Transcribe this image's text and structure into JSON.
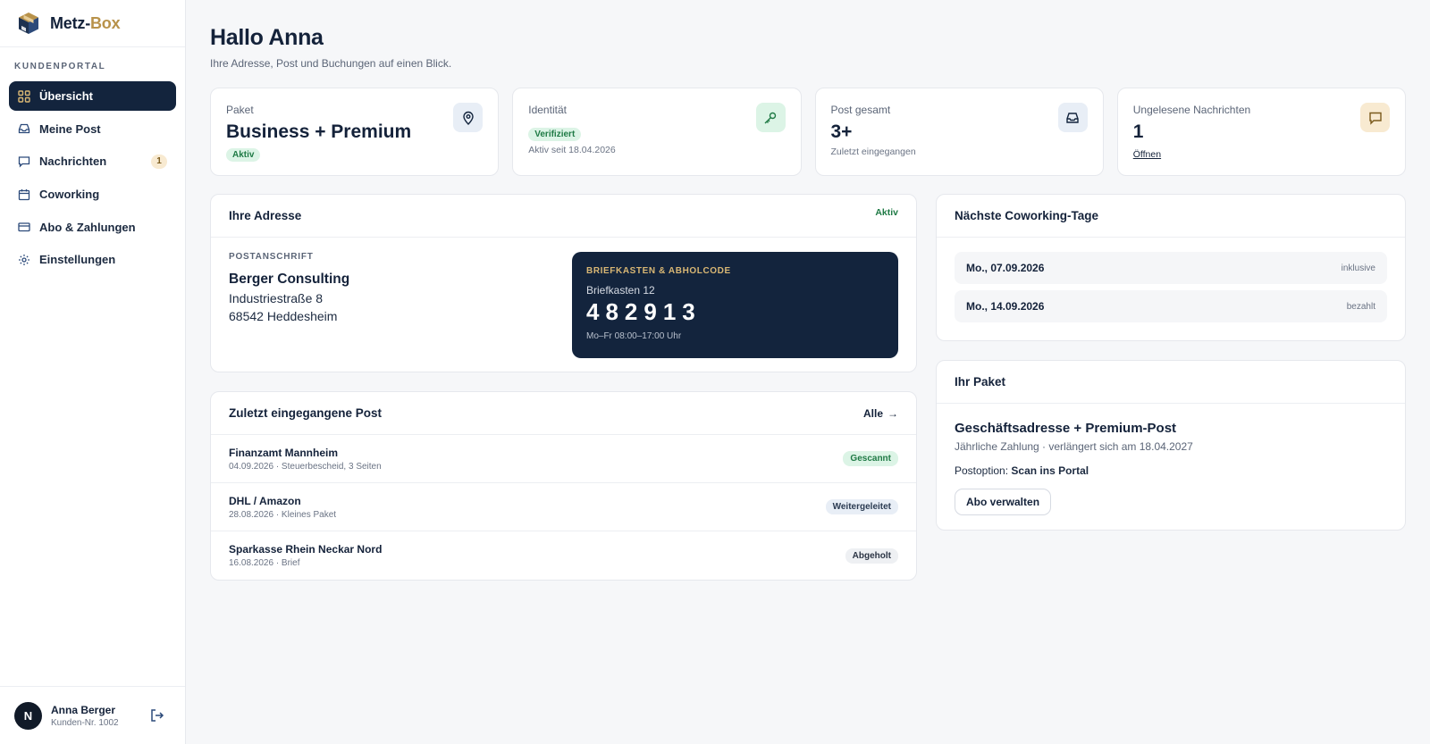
{
  "brand": {
    "name_main": "Metz-",
    "name_accent": "Box",
    "accent_color": "#b8924a"
  },
  "sidebar": {
    "section_label": "KUNDENPORTAL",
    "items": [
      {
        "label": "Übersicht",
        "icon": "grid-icon",
        "active": true
      },
      {
        "label": "Meine Post",
        "icon": "inbox-icon"
      },
      {
        "label": "Nachrichten",
        "icon": "message-icon",
        "badge": "1"
      },
      {
        "label": "Coworking",
        "icon": "calendar-icon"
      },
      {
        "label": "Abo & Zahlungen",
        "icon": "credit-card-icon"
      },
      {
        "label": "Einstellungen",
        "icon": "gear-icon"
      }
    ],
    "user": {
      "initial": "N",
      "name": "Anna Berger",
      "customer_no": "Kunden-Nr. 1002"
    }
  },
  "header": {
    "title": "Hallo Anna",
    "subtitle": "Ihre Adresse, Post und Buchungen auf einen Blick."
  },
  "stats": [
    {
      "label": "Paket",
      "value": "Business + Premium",
      "badge": "Aktiv",
      "icon": "location-pin-icon",
      "icon_bg": "#e8eef6"
    },
    {
      "label": "Identität",
      "badge": "Verifiziert",
      "sub": "Aktiv seit 18.04.2026",
      "icon": "key-icon",
      "icon_bg": "#dcf4e6"
    },
    {
      "label": "Post gesamt",
      "value": "3+",
      "sub": "Zuletzt eingegangen",
      "icon": "inbox-icon",
      "icon_bg": "#e8eef6"
    },
    {
      "label": "Ungelesene Nachrichten",
      "value": "1",
      "link": "Öffnen",
      "icon": "message-icon",
      "icon_bg": "#f8ead1"
    }
  ],
  "address": {
    "title": "Ihre Adresse",
    "status": "Aktiv",
    "caption": "POSTANSCHRIFT",
    "company": "Berger Consulting",
    "street": "Industriestraße 8",
    "city": "68542 Heddesheim",
    "mailbox": {
      "label": "BRIEFKASTEN & ABHOLCODE",
      "name": "Briefkasten 12",
      "code": "482913",
      "hours": "Mo–Fr 08:00–17:00 Uhr"
    }
  },
  "post": {
    "title": "Zuletzt eingegangene Post",
    "all_label": "Alle",
    "items": [
      {
        "sender": "Finanzamt Mannheim",
        "meta": "04.09.2026 · Steuerbescheid, 3 Seiten",
        "status": "Gescannt"
      },
      {
        "sender": "DHL / Amazon",
        "meta": "28.08.2026 · Kleines Paket",
        "status": "Weitergeleitet"
      },
      {
        "sender": "Sparkasse Rhein Neckar Nord",
        "meta": "16.08.2026 · Brief",
        "status": "Abgeholt"
      }
    ]
  },
  "coworking": {
    "title": "Nächste Coworking-Tage",
    "days": [
      {
        "date": "Mo., 07.09.2026",
        "tag": "inklusive"
      },
      {
        "date": "Mo., 14.09.2026",
        "tag": "bezahlt"
      }
    ]
  },
  "package": {
    "title": "Ihr Paket",
    "name": "Geschäftsadresse + Premium-Post",
    "sub": "Jährliche Zahlung · verlängert sich am 18.04.2027",
    "option_label": "Postoption:",
    "option_value": "Scan ins Portal",
    "button": "Abo verwalten"
  }
}
